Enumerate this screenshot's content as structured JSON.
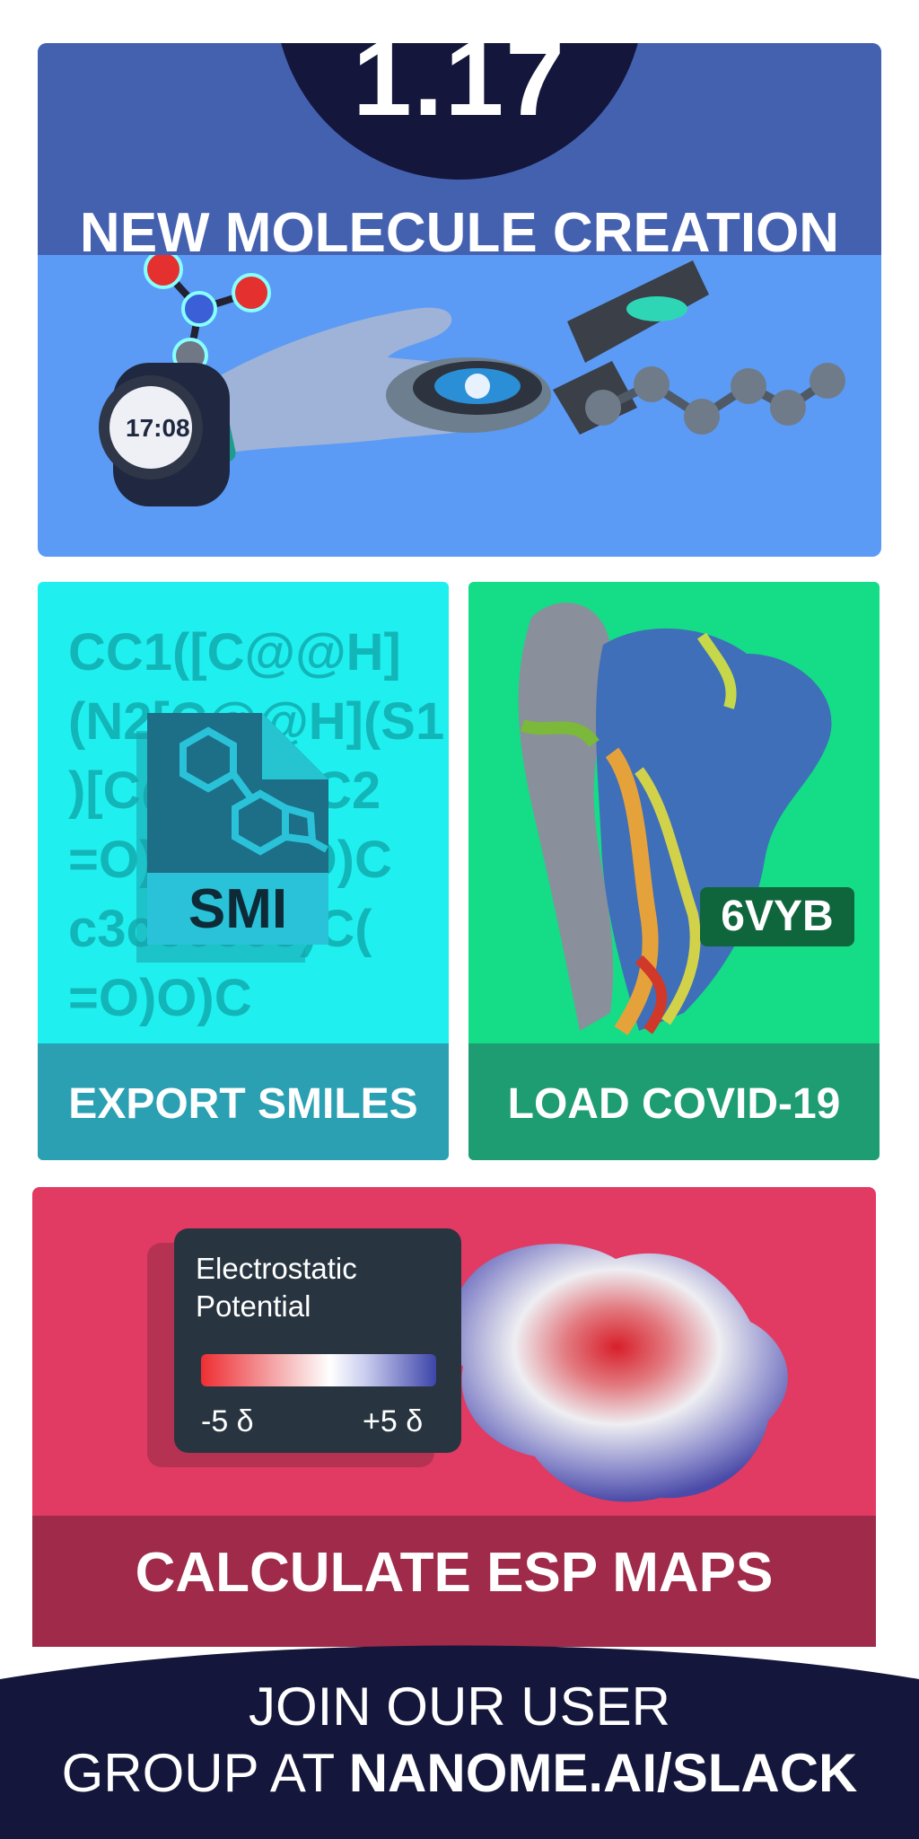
{
  "header": {
    "version": "1.17",
    "title": "NEW MOLECULE CREATION"
  },
  "smiles_card": {
    "smiles_text": "CC1([C@@H]\n(N2[C@@H](S1\n)[C@@H](C2\n=O)N(C(=O)C\nc3ccccc3)C(\n=O)O)C",
    "file_icon_label": "SMI",
    "label": "EXPORT SMILES"
  },
  "covid_card": {
    "pdb_id": "6VYB",
    "label": "LOAD COVID-19"
  },
  "esp_panel": {
    "legend_title": "Electrostatic\nPotential",
    "legend_min": "-5 δ",
    "legend_max": "+5 δ",
    "label": "CALCULATE ESP MAPS"
  },
  "footer": {
    "line1": "JOIN OUR USER",
    "line2_prefix": "GROUP AT ",
    "line2_link": "NANOME.AI/SLACK"
  },
  "watch_time": "17:08",
  "colors": {
    "navy": "#14163b",
    "header_blue": "#4461b0",
    "top_bg": "#5b9bf5",
    "cyan_card": "#20eff0",
    "green_card": "#15dc86",
    "esp_pink": "#e13a63"
  }
}
